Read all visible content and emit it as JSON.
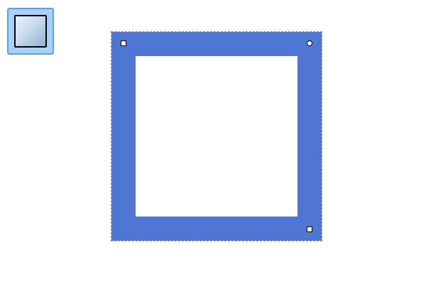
{
  "toolbar": {
    "tool": {
      "icon": "frame-shape-icon",
      "state": "selected"
    }
  },
  "canvas": {
    "shape": {
      "kind": "frame",
      "fill_color": "#4e76d2",
      "selected": true,
      "handles": [
        {
          "name": "top-left",
          "style": "square"
        },
        {
          "name": "top-right",
          "style": "round"
        },
        {
          "name": "bottom-right",
          "style": "square"
        }
      ]
    }
  },
  "colors": {
    "accent": "#4e76d2",
    "tool_bg": "#a9d0f5",
    "tool_border": "#5aa2e6",
    "selection_outline": "#8a94a8"
  }
}
